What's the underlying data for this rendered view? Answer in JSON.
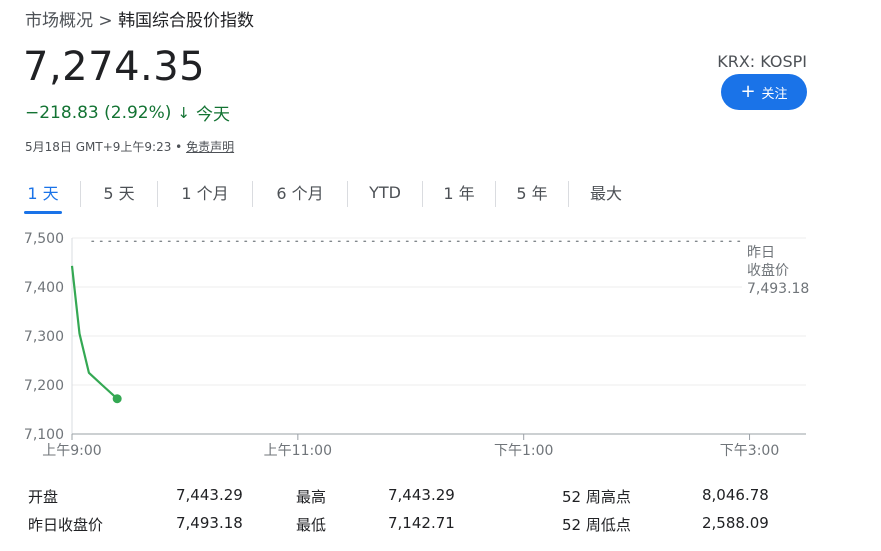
{
  "breadcrumb": {
    "parent": "市场概况",
    "separator": ">",
    "current": "韩国综合股价指数"
  },
  "quote": {
    "price": "7,274.35",
    "change": "−218.83 (2.92%)",
    "arrow": "↓",
    "period": "今天",
    "timestamp": "5月18日 GMT+9上午9:23",
    "bullet": "•",
    "disclaimer": "免责声明"
  },
  "ticker": "KRX: KOSPI",
  "follow_button": {
    "icon": "plus-icon",
    "label": "关注"
  },
  "tabs": [
    "1 天",
    "5 天",
    "1 个月",
    "6 个月",
    "YTD",
    "1 年",
    "5 年",
    "最大"
  ],
  "active_tab": "1 天",
  "colors": {
    "accent": "#1a73e8",
    "down": "#137333",
    "line": "#34a853"
  },
  "chart_data": {
    "type": "line",
    "y_ticks": [
      "7,500",
      "7,400",
      "7,300",
      "7,200",
      "7,100"
    ],
    "ylim": [
      7100,
      7500
    ],
    "x_ticks": [
      "上午9:00",
      "上午11:00",
      "下午1:00",
      "下午3:00"
    ],
    "x_tick_minutes": [
      0,
      120,
      240,
      360
    ],
    "xlim_minutes": [
      0,
      390
    ],
    "series": [
      {
        "x_minutes": [
          0,
          4,
          9,
          16,
          24
        ],
        "values": [
          7443,
          7305,
          7225,
          7200,
          7172
        ]
      }
    ],
    "reference": {
      "label_line1": "昨日",
      "label_line2": "收盘价",
      "value_text": "7,493.18",
      "value": 7493.18
    },
    "grid": true
  },
  "stats": [
    {
      "label": "开盘",
      "value": "7,443.29",
      "label2": "最高",
      "value2": "7,443.29",
      "label3": "52 周高点",
      "value3": "8,046.78"
    },
    {
      "label": "昨日收盘价",
      "value": "7,493.18",
      "label2": "最低",
      "value2": "7,142.71",
      "label3": "52 周低点",
      "value3": "2,588.09"
    }
  ]
}
